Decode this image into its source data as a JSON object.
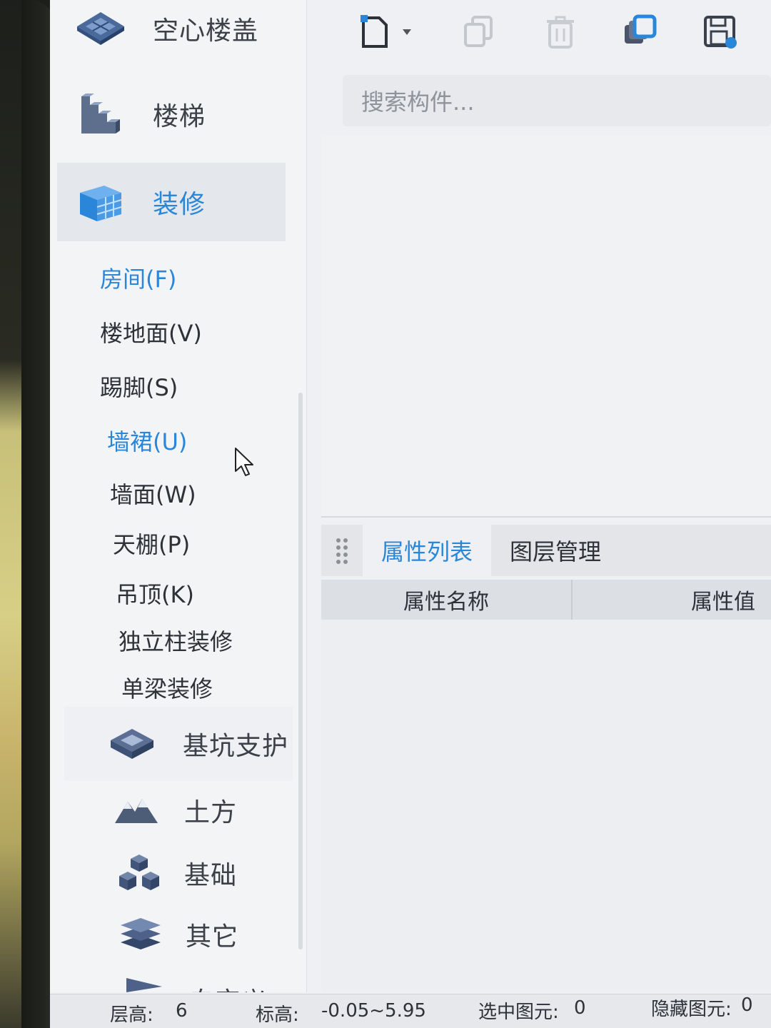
{
  "nav": {
    "categories": [
      {
        "label": "空心楼盖",
        "icon": "hollow-slab-icon"
      },
      {
        "label": "楼梯",
        "icon": "stairs-icon"
      },
      {
        "label": "装修",
        "icon": "decoration-icon",
        "active": true
      },
      {
        "label": "基坑支护",
        "icon": "foundation-pit-icon"
      },
      {
        "label": "土方",
        "icon": "earthwork-icon"
      },
      {
        "label": "基础",
        "icon": "foundation-icon"
      },
      {
        "label": "其它",
        "icon": "other-icon"
      },
      {
        "label": "自定义",
        "icon": "custom-icon"
      }
    ],
    "sub_items": [
      {
        "label": "房间(F)",
        "selected": true
      },
      {
        "label": "楼地面(V)"
      },
      {
        "label": "踢脚(S)"
      },
      {
        "label": "墙裙(U)",
        "hover": true
      },
      {
        "label": "墙面(W)"
      },
      {
        "label": "天棚(P)"
      },
      {
        "label": "吊顶(K)"
      },
      {
        "label": "独立柱装修"
      },
      {
        "label": "单梁装修"
      }
    ]
  },
  "toolbar": {
    "buttons": [
      "new-icon",
      "dropdown-arrow-icon",
      "copy-icon",
      "delete-icon",
      "layer-copy-icon",
      "save-icon"
    ]
  },
  "search": {
    "placeholder": "搜索构件..."
  },
  "tabs": {
    "properties": "属性列表",
    "layers": "图层管理"
  },
  "table": {
    "col_name": "属性名称",
    "col_value": "属性值"
  },
  "status": {
    "floor_label": "层高:",
    "floor_value": "6",
    "elev_label": "标高:",
    "elev_value": "-0.05~5.95",
    "selected_label": "选中图元:",
    "selected_value": "0",
    "hidden_label": "隐藏图元:",
    "hidden_value": "0"
  },
  "colors": {
    "accent": "#2a86d8",
    "text": "#2e3138",
    "panel": "#eef0f3"
  }
}
